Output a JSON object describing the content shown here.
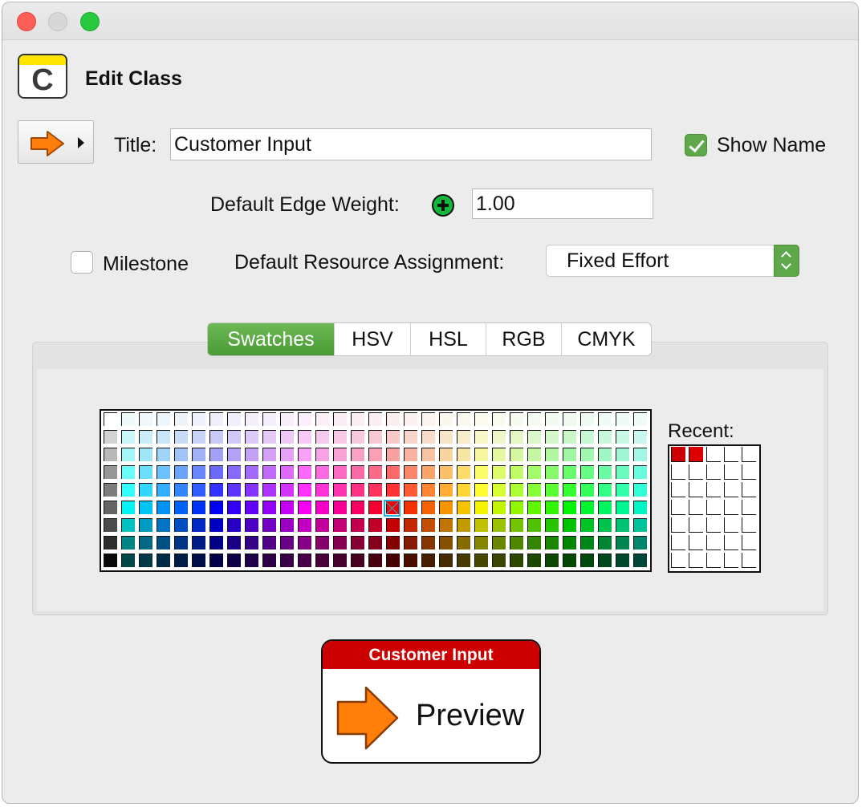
{
  "window": {
    "controls": [
      "close-icon",
      "minimize-icon",
      "maximize-icon"
    ]
  },
  "header": {
    "icon_letter": "C",
    "title": "Edit Class"
  },
  "form": {
    "shape_icon": "orange-arrow-icon",
    "title_label": "Title:",
    "title_value": "Customer Input",
    "show_name_label": "Show Name",
    "show_name_checked": true,
    "edge_weight_label": "Default Edge Weight:",
    "edge_weight_value": "1.00",
    "milestone_label": "Milestone",
    "milestone_checked": false,
    "resource_label": "Default Resource Assignment:",
    "resource_value": "Fixed Effort"
  },
  "color_tabs": {
    "tabs": [
      "Swatches",
      "HSV",
      "HSL",
      "RGB",
      "CMYK"
    ],
    "active": "Swatches"
  },
  "swatches": {
    "recent_label": "Recent:",
    "recent_colors": [
      "#cc0000",
      "#dd0000"
    ],
    "selected_color": "#800000"
  },
  "preview": {
    "title": "Customer Input",
    "text": "Preview",
    "header_color": "#cc0000",
    "arrow_color": "#ff7f0a"
  },
  "colors": {
    "accent_green": "#5fa84a",
    "window_bg": "#ececec"
  }
}
